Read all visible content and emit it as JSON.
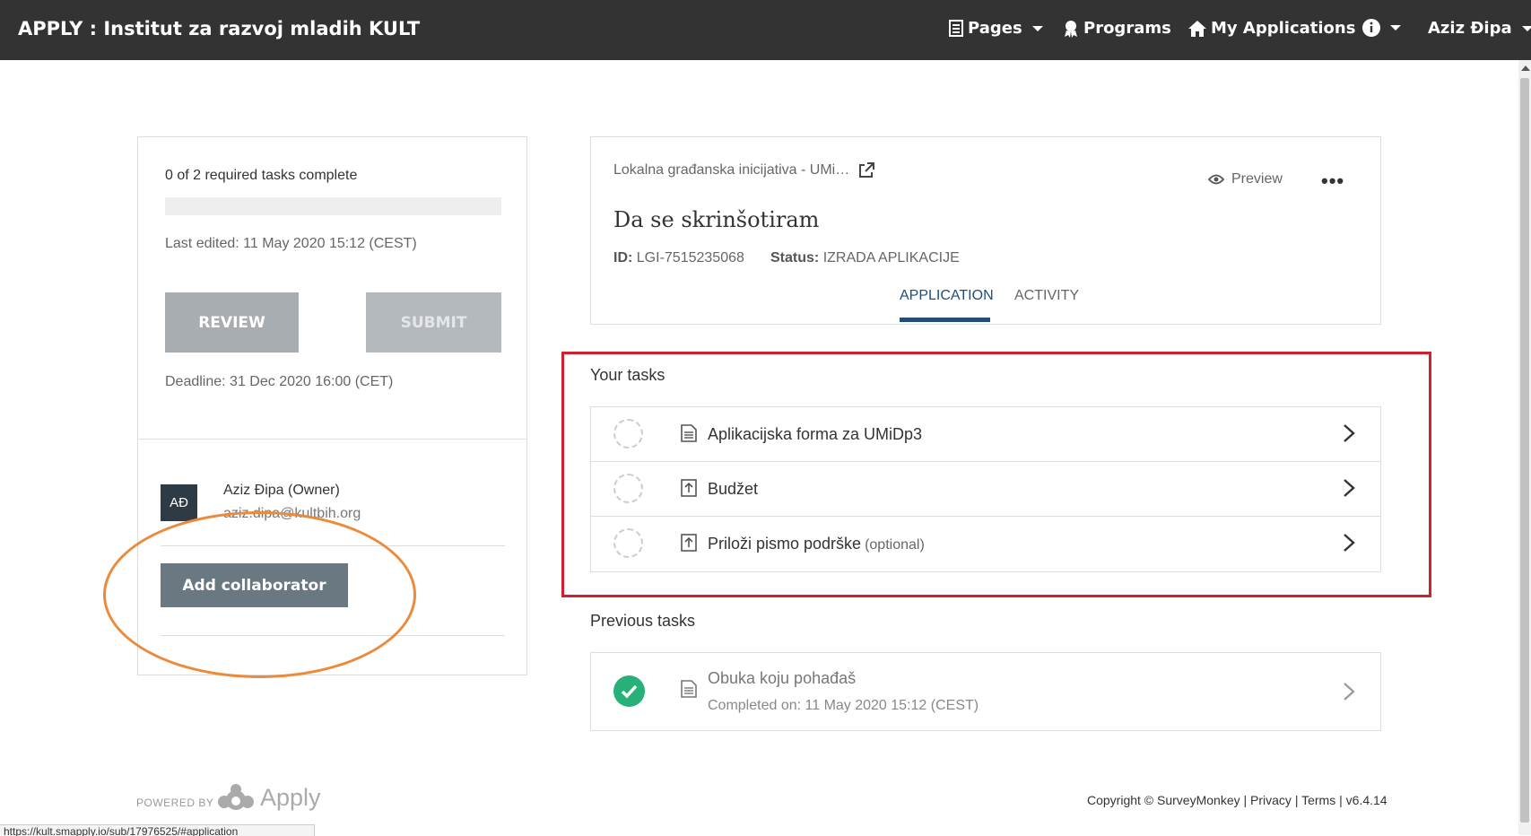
{
  "navbar": {
    "brand": "APPLY : Institut za razvoj mladih KULT",
    "pages_label": "Pages",
    "programs_label": "Programs",
    "my_applications_label": "My Applications",
    "user_name": "Aziz Đipa"
  },
  "sidebar": {
    "task_count": "0 of 2 required tasks complete",
    "progress_fraction": 0,
    "last_edited": "Last edited: 11 May 2020 15:12 (CEST)",
    "review_label": "REVIEW",
    "submit_label": "SUBMIT",
    "deadline": "Deadline: 31 Dec 2020 16:00 (CET)",
    "owner": {
      "initials": "AĐ",
      "name": "Aziz Đipa (Owner)",
      "email": "aziz.dipa@kultbih.org"
    },
    "add_collaborator_label": "Add collaborator"
  },
  "application": {
    "program_name": "Lokalna građanska inicijativa - UMi…",
    "preview_label": "Preview",
    "title": "Da se skrinšotiram",
    "id_label": "ID:",
    "id_value": "LGI-7515235068",
    "status_label": "Status:",
    "status_value": "IZRADA APLIKACIJE",
    "tabs": [
      {
        "label": "APPLICATION",
        "active": true
      },
      {
        "label": "ACTIVITY",
        "active": false
      }
    ]
  },
  "your_tasks": {
    "title": "Your tasks",
    "items": [
      {
        "label": "Aplikacijska forma za UMiDp3",
        "icon": "document-icon",
        "optional": ""
      },
      {
        "label": "Budžet",
        "icon": "upload-icon",
        "optional": ""
      },
      {
        "label": "Priloži pismo podrške",
        "icon": "upload-icon",
        "optional": "(optional)"
      }
    ]
  },
  "previous_tasks": {
    "title": "Previous tasks",
    "items": [
      {
        "label": "Obuka koju pohađaš",
        "completed": "Completed on: 11 May 2020 15:12 (CEST)"
      }
    ]
  },
  "footer": {
    "powered_by": "POWERED BY",
    "logo_text": "Apply",
    "copyright": "Copyright © SurveyMonkey",
    "privacy": "Privacy",
    "terms": "Terms",
    "version": "v6.4.14",
    "status_url": "https://kult.smapply.io/sub/17976525/#application"
  },
  "colors": {
    "navbar_bg": "#333333",
    "tab_active": "#1f4e79",
    "highlight_red": "#d0202c",
    "highlight_orange": "#ec8a3c",
    "success_green": "#27b078"
  }
}
